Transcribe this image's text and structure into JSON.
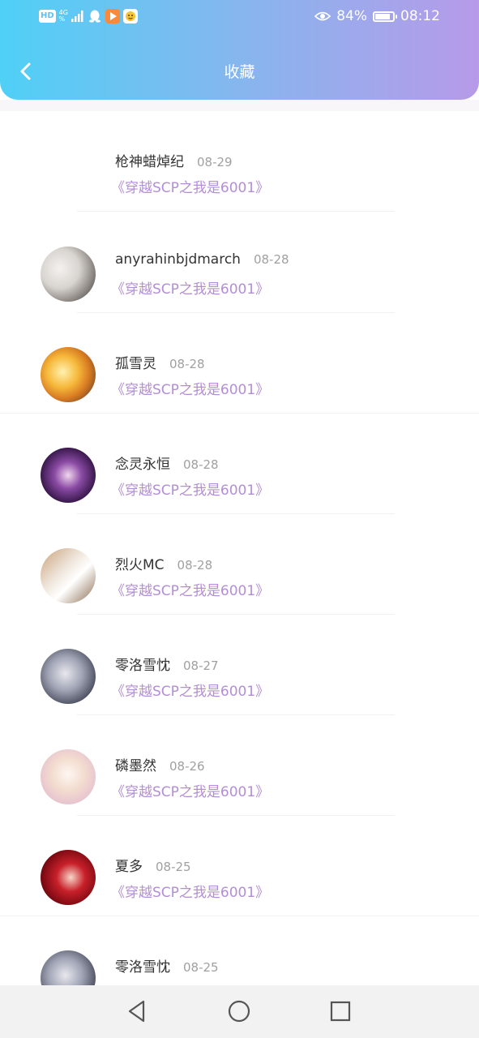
{
  "status_bar": {
    "network_badge": "HD",
    "network_type": "4G",
    "network_sub": "%",
    "battery_percent": "84%",
    "battery_level": 0.84,
    "time": "08:12",
    "icons": [
      "signal-icon",
      "qq-icon",
      "video-app-icon",
      "emoji-app-icon",
      "eye-icon",
      "battery-icon"
    ]
  },
  "header": {
    "title": "收藏",
    "back_icon": "chevron-left-icon"
  },
  "list": {
    "items": [
      {
        "user": "枪神蜡焯纪",
        "date": "08-29",
        "book": "《穿越SCP之我是6001》",
        "avatar": "none"
      },
      {
        "user": "anyrahinbjdmarch",
        "date": "08-28",
        "book": "《穿越SCP之我是6001》",
        "avatar": "white-haired-character"
      },
      {
        "user": "孤雪灵",
        "date": "08-28",
        "book": "《穿越SCP之我是6001》",
        "avatar": "blonde-character"
      },
      {
        "user": "念灵永恒",
        "date": "08-28",
        "book": "《穿越SCP之我是6001》",
        "avatar": "purple-dark-character"
      },
      {
        "user": "烈火MC",
        "date": "08-28",
        "book": "《穿越SCP之我是6001》",
        "avatar": "paper-notes"
      },
      {
        "user": "零洛雪忱",
        "date": "08-27",
        "book": "《穿越SCP之我是6001》",
        "avatar": "grey-haired-character"
      },
      {
        "user": "磷墨然",
        "date": "08-26",
        "book": "《穿越SCP之我是6001》",
        "avatar": "pastel-character"
      },
      {
        "user": "夏多",
        "date": "08-25",
        "book": "《穿越SCP之我是6001》",
        "avatar": "red-haired-character"
      },
      {
        "user": "零洛雪忱",
        "date": "08-25",
        "book": "",
        "avatar": "grey-haired-character"
      }
    ]
  },
  "bottom_nav": {
    "icons": [
      "back-triangle-icon",
      "home-circle-icon",
      "recents-square-icon"
    ]
  },
  "colors": {
    "header_gradient_start": "#4fd0f6",
    "header_gradient_end": "#b79ae9",
    "book_title": "#b38ed6",
    "user_name": "#333333",
    "date": "#a0a0a0"
  }
}
